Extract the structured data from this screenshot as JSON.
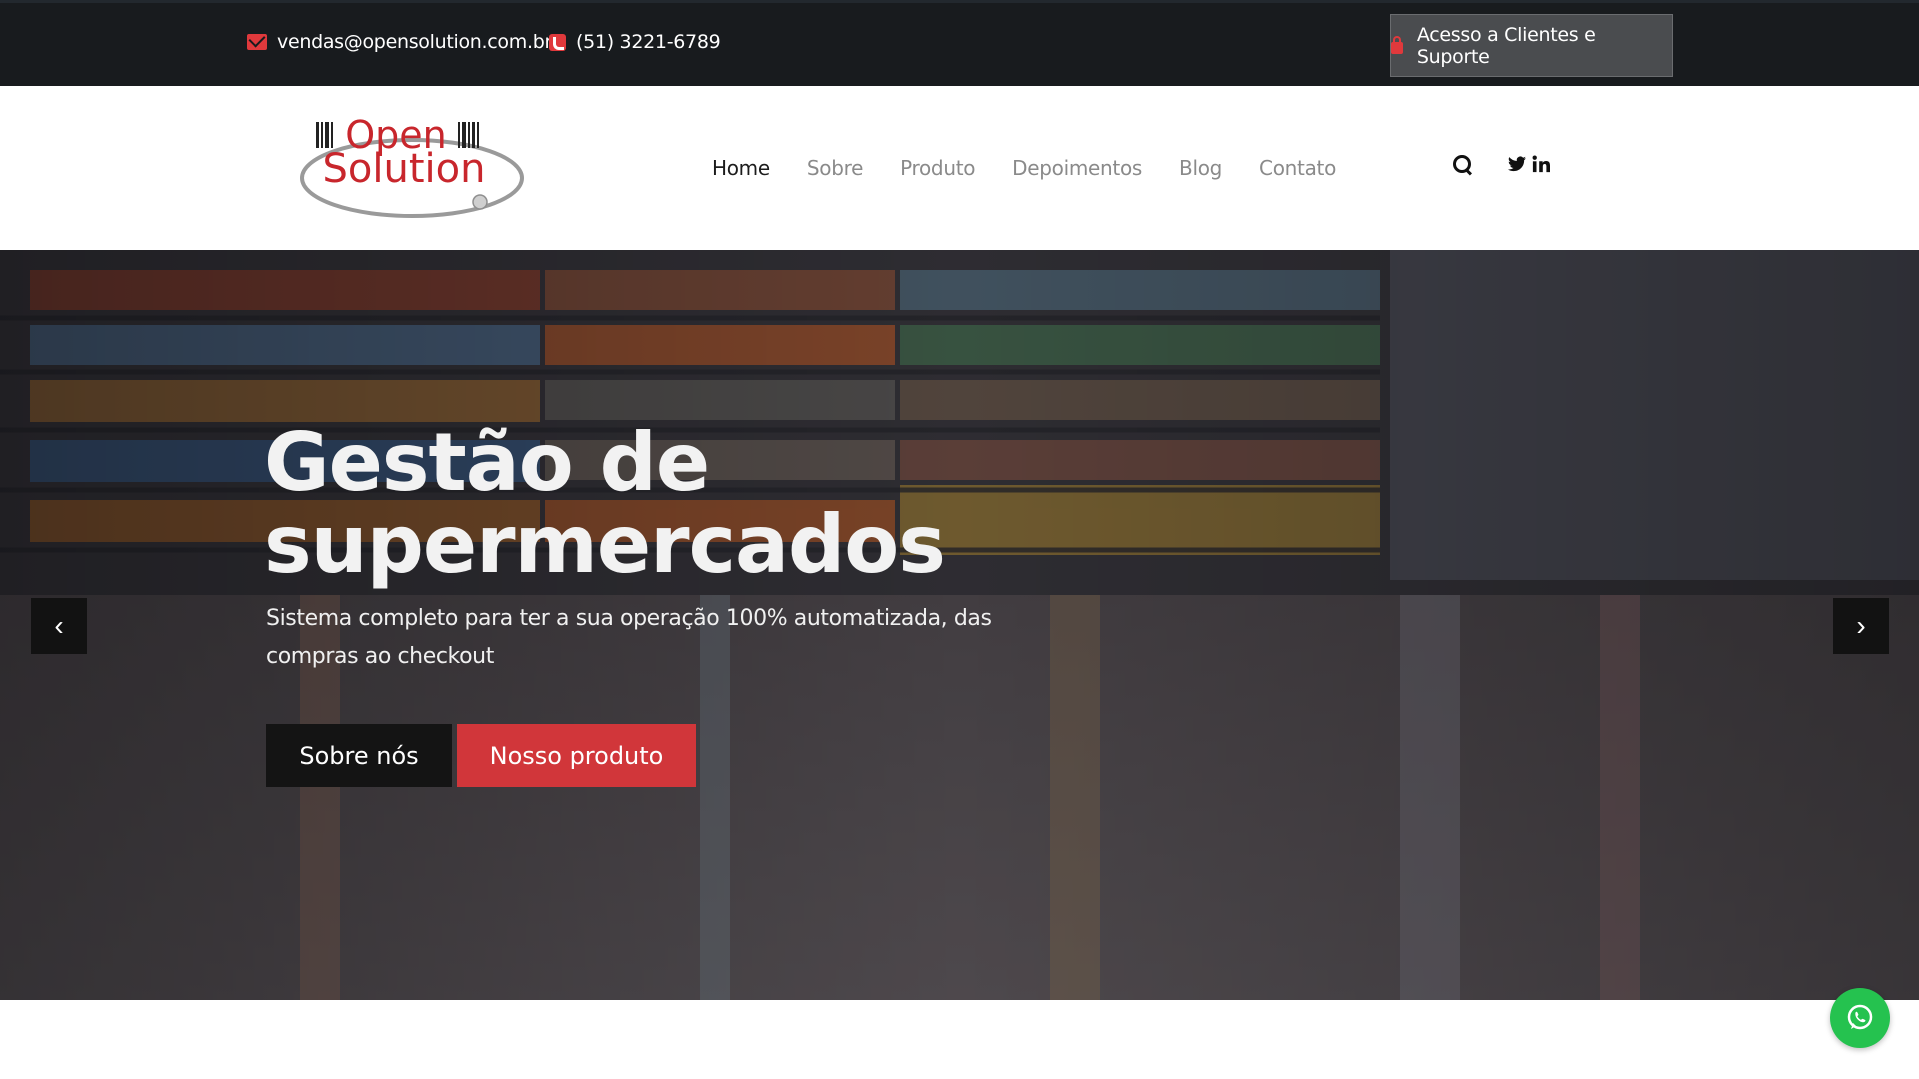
{
  "topbar": {
    "email": "vendas@opensolution.com.br",
    "phone": "(51) 3221-6789",
    "support_label": "Acesso a Clientes e Suporte",
    "icons": {
      "email": "envelope-icon",
      "phone": "phone-icon",
      "support": "lock-icon"
    }
  },
  "header": {
    "logo_line1": "Open",
    "logo_line2": "Solution",
    "nav": [
      "Home",
      "Sobre",
      "Produto",
      "Depoimentos",
      "Blog",
      "Contato"
    ],
    "social": {
      "twitter": "twitter-icon",
      "linkedin": "linkedin-icon"
    },
    "search": "search-icon"
  },
  "hero": {
    "title": "Gestão de supermercados",
    "subtitle": "Sistema completo para ter a sua operação 100% automatizada, das compras ao checkout",
    "btn_about": "Sobre nós",
    "btn_product": "Nosso produto",
    "prev_icon": "‹",
    "next_icon": "›"
  },
  "whatsapp": "whatsapp-icon",
  "colors": {
    "accent": "#d1363a",
    "topbar": "#181b1e",
    "whatsapp": "#25c24f"
  }
}
